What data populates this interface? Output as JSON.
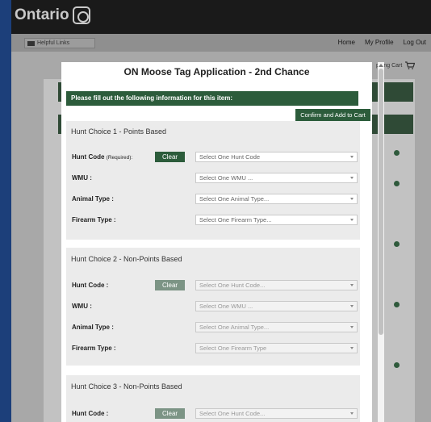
{
  "header": {
    "logo_text": "Ontario",
    "helpful_links": "Helpful Links",
    "nav": [
      "Home",
      "My Profile",
      "Log Out"
    ],
    "cart_label": "pping Cart"
  },
  "modal": {
    "title": "ON Moose Tag Application - 2nd Chance",
    "info_bar": "Please fill out the following information for this item:",
    "confirm_button": "Confirm and Add to Cart",
    "clear_label": "Clear",
    "sections": [
      {
        "title": "Hunt Choice 1 - Points Based",
        "hunt_code_label": "Hunt Code",
        "required_note": "(Required):",
        "hunt_code_placeholder": "Select One Hunt Code",
        "wmu_label": "WMU :",
        "wmu_placeholder": "Select One WMU ...",
        "animal_label": "Animal Type :",
        "animal_placeholder": "Select One Animal Type...",
        "firearm_label": "Firearm Type :",
        "firearm_placeholder": "Select One Firearm Type..."
      },
      {
        "title": "Hunt Choice 2 - Non-Points Based",
        "hunt_code_label": "Hunt Code :",
        "hunt_code_placeholder": "Select One Hunt Code...",
        "wmu_label": "WMU :",
        "wmu_placeholder": "Select One WMU ...",
        "animal_label": "Animal Type :",
        "animal_placeholder": "Select One Animal Type...",
        "firearm_label": "Firearm Type :",
        "firearm_placeholder": "Select One Firearm Type"
      },
      {
        "title": "Hunt Choice 3 - Non-Points Based",
        "hunt_code_label": "Hunt Code :",
        "hunt_code_placeholder": "Select One Hunt Code..."
      }
    ]
  },
  "colors": {
    "brand_green": "#2c5c3b",
    "page_blue": "#1c3f7a",
    "header_dark": "#1a1a1a"
  }
}
